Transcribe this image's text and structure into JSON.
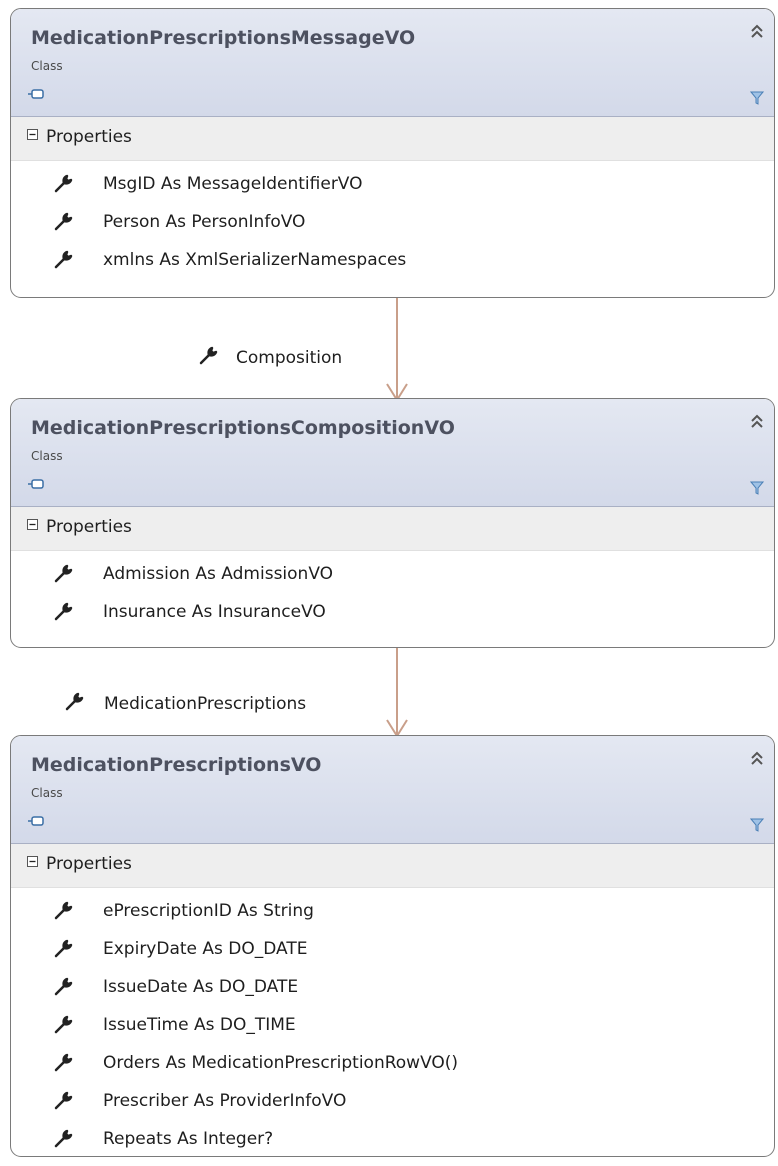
{
  "classes": [
    {
      "name": "MedicationPrescriptionsMessageVO",
      "kind": "Class",
      "section": "Properties",
      "properties": [
        "MsgID As MessageIdentifierVO",
        "Person As PersonInfoVO",
        "xmlns As XmlSerializerNamespaces"
      ]
    },
    {
      "name": "MedicationPrescriptionsCompositionVO",
      "kind": "Class",
      "section": "Properties",
      "properties": [
        "Admission As AdmissionVO",
        "Insurance As InsuranceVO"
      ]
    },
    {
      "name": "MedicationPrescriptionsVO",
      "kind": "Class",
      "section": "Properties",
      "properties": [
        "ePrescriptionID As String",
        "ExpiryDate As DO_DATE",
        "IssueDate As DO_DATE",
        "IssueTime As DO_TIME",
        "Orders As MedicationPrescriptionRowVO()",
        "Prescriber As ProviderInfoVO",
        "Repeats As Integer?"
      ]
    }
  ],
  "associations": [
    {
      "label": "Composition",
      "line_color": "#c99f8a"
    },
    {
      "label": "MedicationPrescriptions",
      "line_color": "#c99f8a"
    }
  ],
  "icons": {
    "property": "wrench-icon",
    "collapse": "double-chevron-up-icon",
    "filter": "filter-icon",
    "section_toggle": "minus-box-icon",
    "class_kind": "class-shape-icon"
  }
}
